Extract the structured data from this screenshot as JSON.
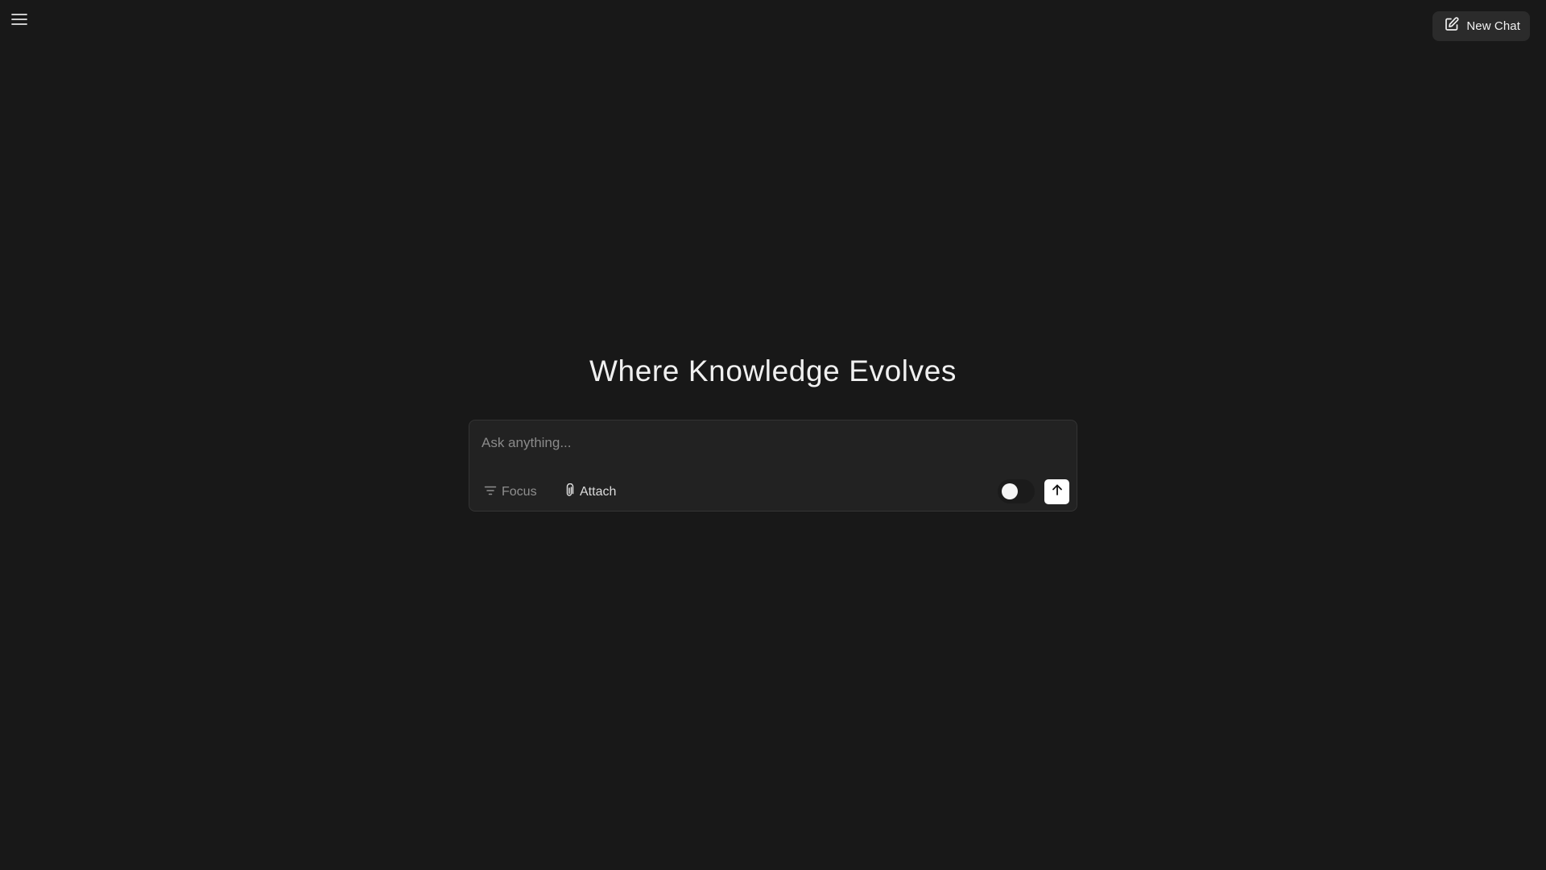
{
  "header": {
    "menu_icon": "hamburger-menu-icon",
    "new_chat": {
      "icon": "pencil-square-icon",
      "label": "New Chat"
    }
  },
  "main": {
    "title": "Where Knowledge Evolves",
    "composer": {
      "value": "",
      "placeholder": "Ask anything...",
      "focus": {
        "icon": "filter-lines-icon",
        "label": "Focus"
      },
      "attach": {
        "icon": "paperclip-icon",
        "label": "Attach"
      },
      "toggle_on": false,
      "send_icon": "arrow-up-icon"
    }
  },
  "colors": {
    "background": "#181818",
    "composer_background": "#222222",
    "composer_border": "#343434",
    "button_background": "#2b2b2b",
    "send_button": "#ffffff",
    "muted_text": "#8f8f8f"
  }
}
